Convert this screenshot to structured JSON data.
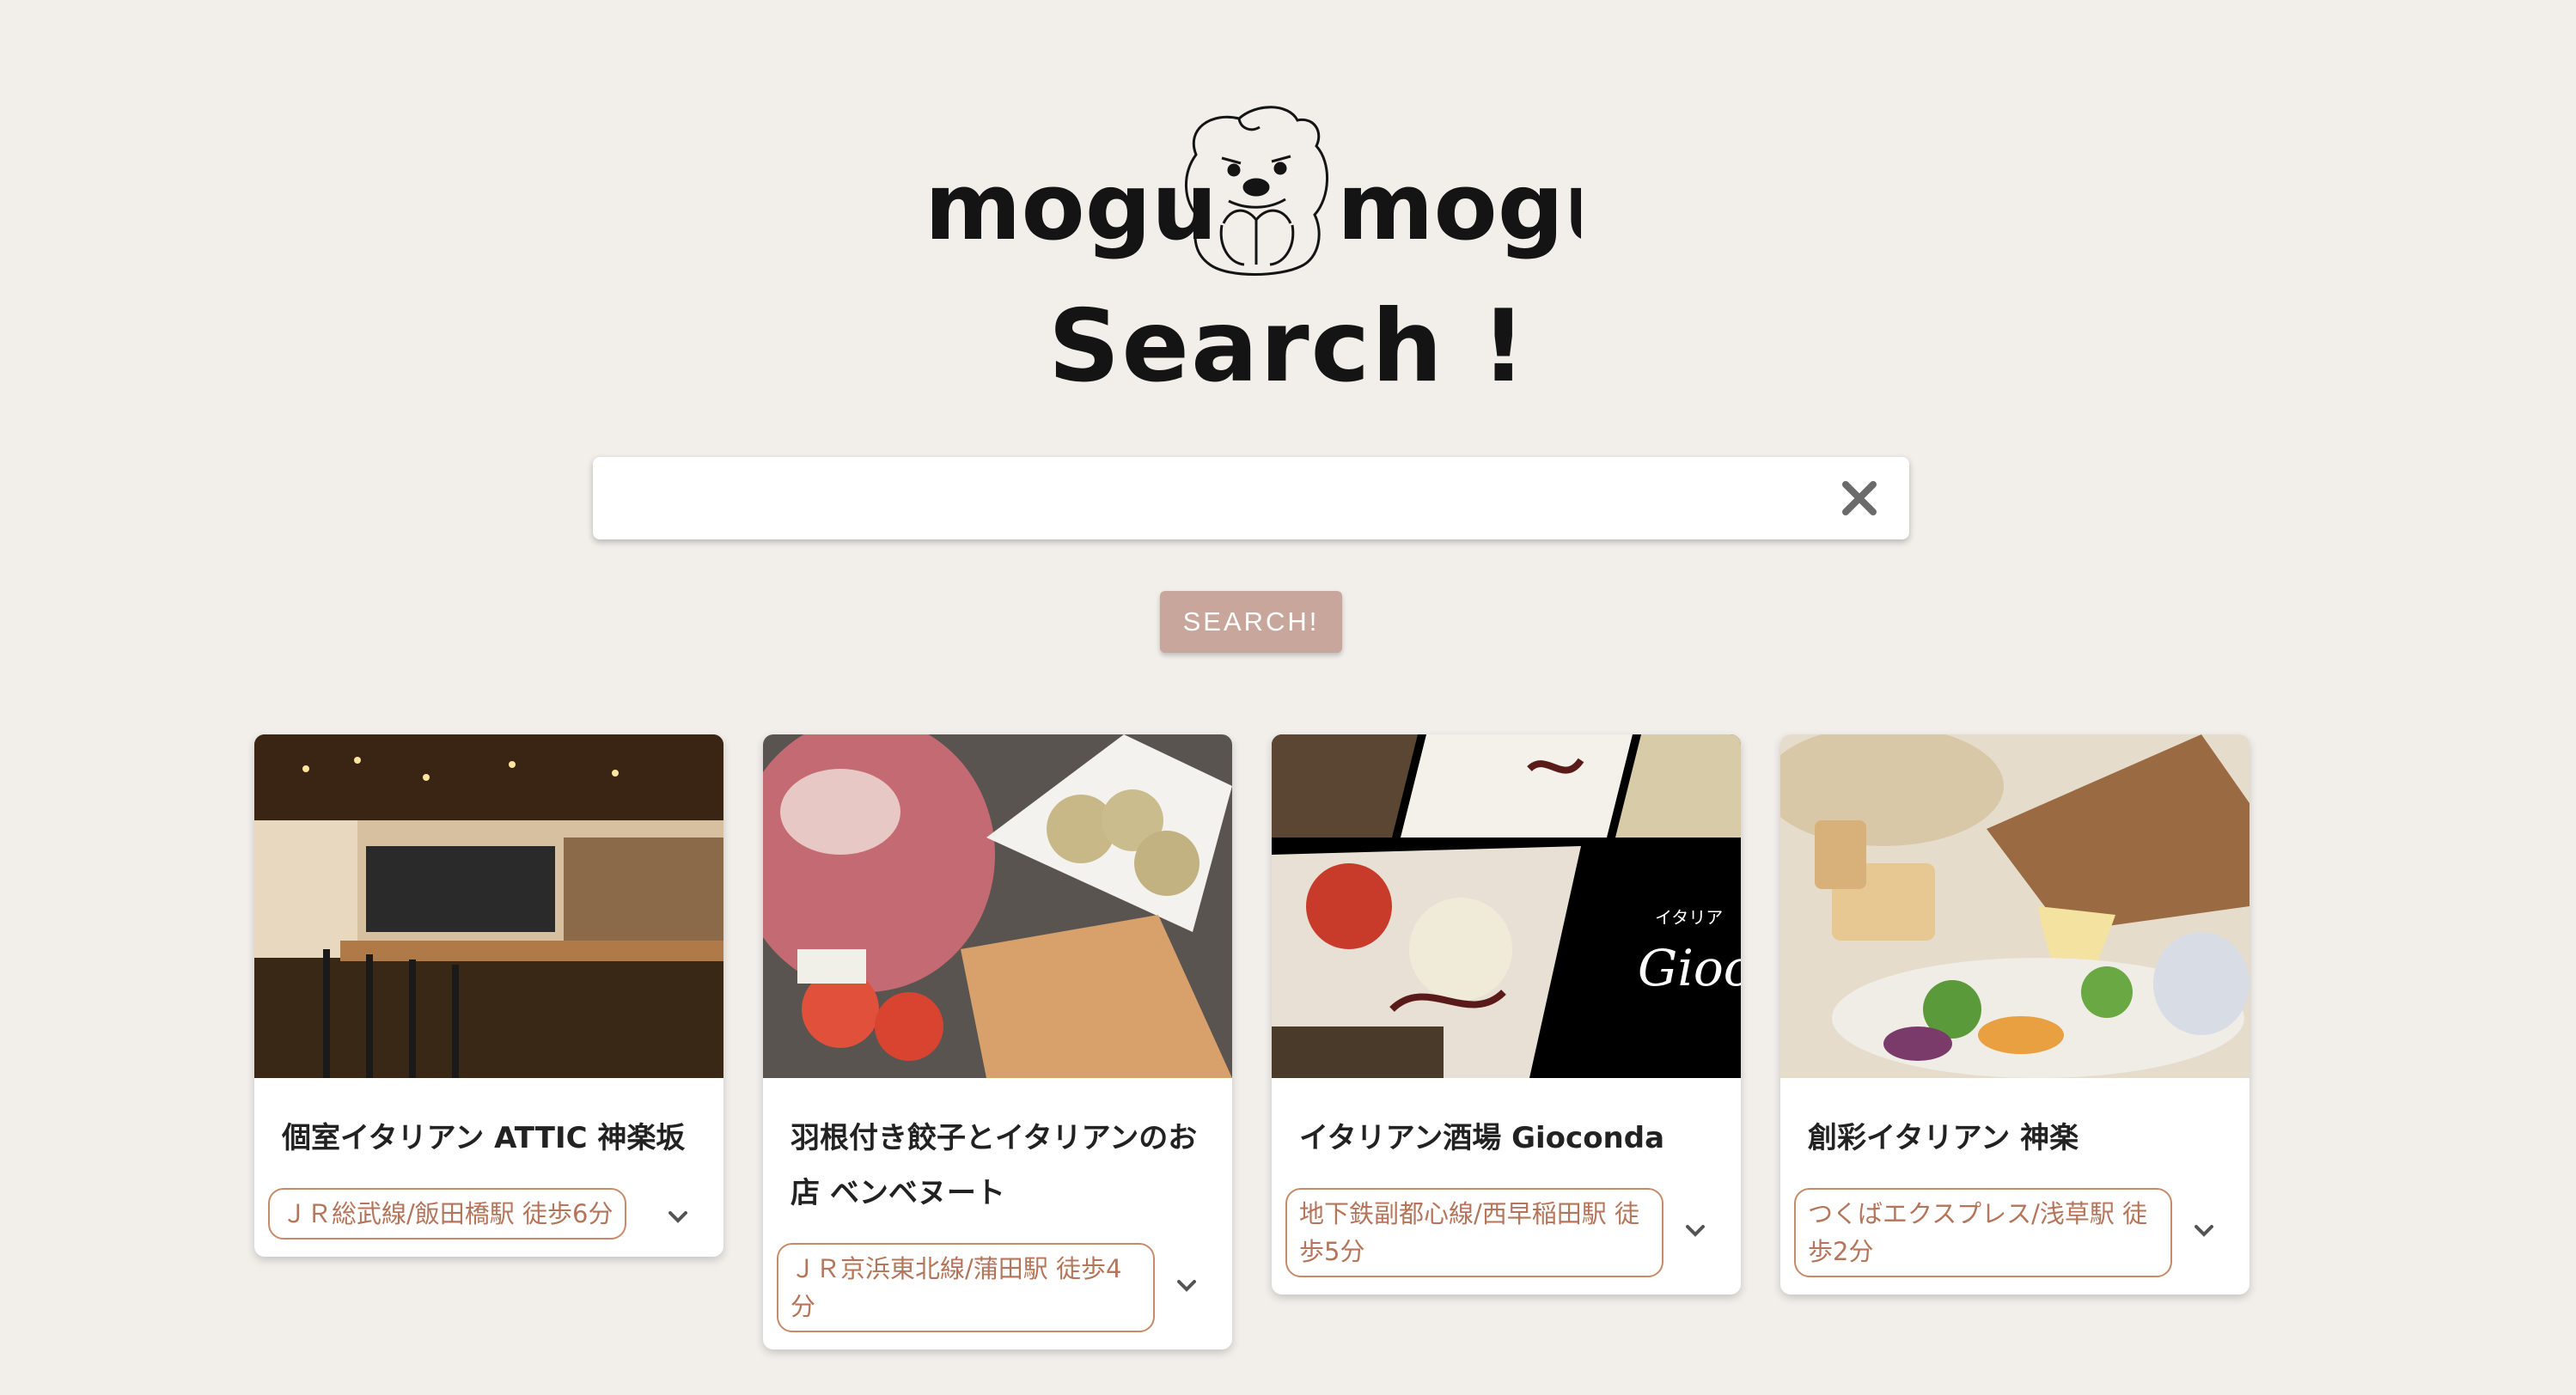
{
  "brand": {
    "logo_text_left": "mogu",
    "logo_text_right": "mogu",
    "subtitle": "Search !"
  },
  "search": {
    "value": "",
    "placeholder": "",
    "clear_icon": "close-icon",
    "button_label": "SEARCH!"
  },
  "colors": {
    "background": "#f2efeb",
    "button": "#c8a69b",
    "chip_border": "#c88b6a",
    "chip_text": "#b4755a"
  },
  "restaurants": [
    {
      "name": "個室イタリアン ATTIC 神楽坂",
      "access": "ＪＲ総武線/飯田橋駅 徒歩6分",
      "expand_icon": "chevron-down-icon"
    },
    {
      "name": "羽根付き餃子とイタリアンのお店 ベンベヌート",
      "access": "ＪＲ京浜東北線/蒲田駅 徒歩4分",
      "expand_icon": "chevron-down-icon"
    },
    {
      "name": "イタリアン酒場 Gioconda",
      "access": "地下鉄副都心線/西早稲田駅 徒歩5分",
      "expand_icon": "chevron-down-icon",
      "photo_text": "イタリア",
      "photo_script": "Giocon"
    },
    {
      "name": "創彩イタリアン 神楽",
      "access": "つくばエクスプレス/浅草駅 徒歩2分",
      "expand_icon": "chevron-down-icon"
    }
  ]
}
